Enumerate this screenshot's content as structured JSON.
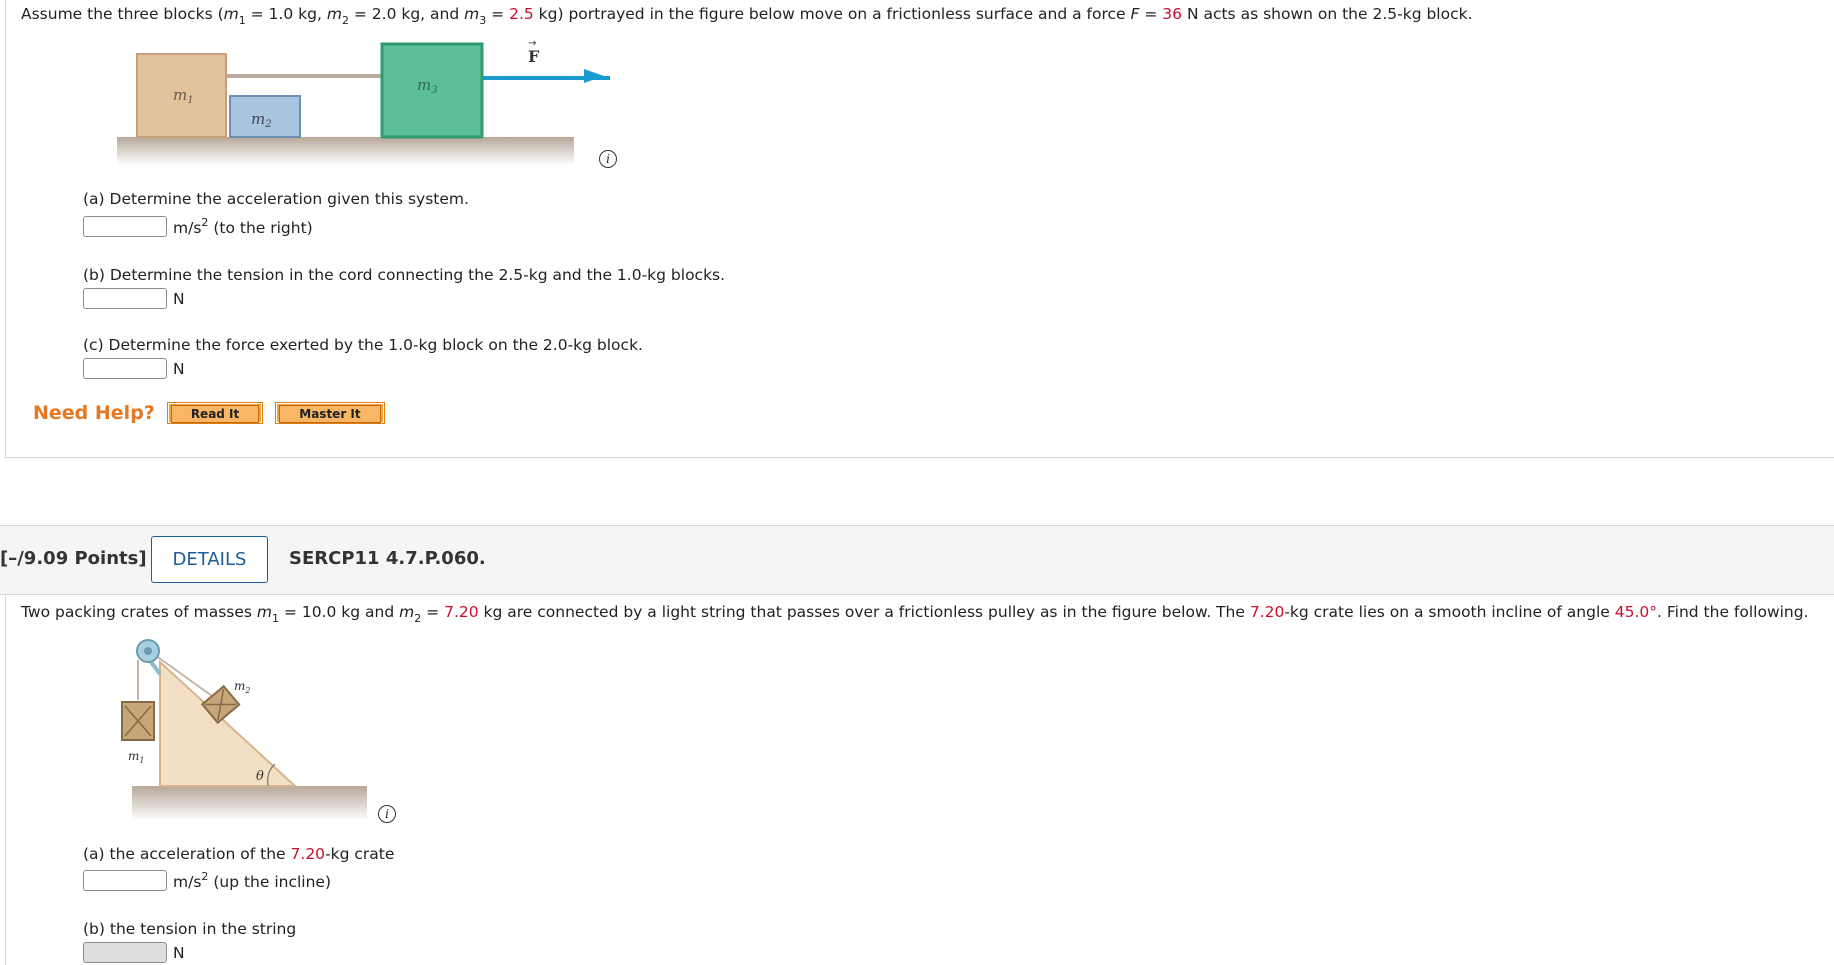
{
  "q1": {
    "stem": {
      "p1": "Assume the three blocks (",
      "m1": "m",
      "m1_sub": "1",
      "m1_eq": " = 1.0 kg, ",
      "m2": "m",
      "m2_sub": "2",
      "m2_eq": " = 2.0 kg, and ",
      "m3": "m",
      "m3_sub": "3",
      "m3_eq": " = ",
      "m3_val": "2.5",
      "p2": " kg) portrayed in the figure below move on a frictionless surface and a force ",
      "F": "F",
      "F_eq": " = ",
      "F_val": "36",
      "p3": " N acts as shown on the 2.5-kg block."
    },
    "figure": {
      "block1_label": "m",
      "block1_sub": "1",
      "block2_label": "m",
      "block2_sub": "2",
      "block3_label": "m",
      "block3_sub": "3",
      "force_label": "F"
    },
    "parts": [
      {
        "text": "(a) Determine the acceleration given this system.",
        "unit": "m/s",
        "unit_sup": "2",
        "unit_suffix": " (to the right)"
      },
      {
        "text": "(b) Determine the tension in the cord connecting the 2.5-kg and the 1.0-kg blocks.",
        "unit": "N"
      },
      {
        "text": "(c) Determine the force exerted by the 1.0-kg block on the 2.0-kg block.",
        "unit": "N"
      }
    ],
    "help": {
      "label": "Need Help?",
      "read_it": "Read It",
      "master_it": "Master It"
    }
  },
  "q2_header": {
    "points": "[–/9.09 Points]",
    "details": "DETAILS",
    "code": "SERCP11 4.7.P.060."
  },
  "q2": {
    "stem": {
      "p1": "Two packing crates of masses ",
      "m1": "m",
      "m1_sub": "1",
      "m1_eq": " = 10.0 kg and ",
      "m2": "m",
      "m2_sub": "2",
      "m2_eq": " = ",
      "m2_val": "7.20",
      "p2": " kg are connected by a light string that passes over a frictionless pulley as in the figure below. The ",
      "m2_val_b": "7.20",
      "p3": "-kg crate lies on a smooth incline of angle ",
      "angle": "45.0°",
      "p4": ". Find the following."
    },
    "figure": {
      "m1_label": "m",
      "m1_sub": "1",
      "m2_label": "m",
      "m2_sub": "2",
      "theta": "θ"
    },
    "parts": [
      {
        "text_a": "(a) the acceleration of the ",
        "val": "7.20",
        "text_b": "-kg crate",
        "unit": "m/s",
        "unit_sup": "2",
        "unit_suffix": " (up the incline)"
      },
      {
        "text": "(b) the tension in the string",
        "unit": "N"
      }
    ]
  },
  "colors": {
    "accent_red": "#c8102e",
    "details_blue": "#1f5c99",
    "help_orange": "#e87722",
    "block1": "#e3c29e",
    "block2": "#a9c4df",
    "block3": "#5dbf98",
    "arrow": "#1a9ad0"
  }
}
